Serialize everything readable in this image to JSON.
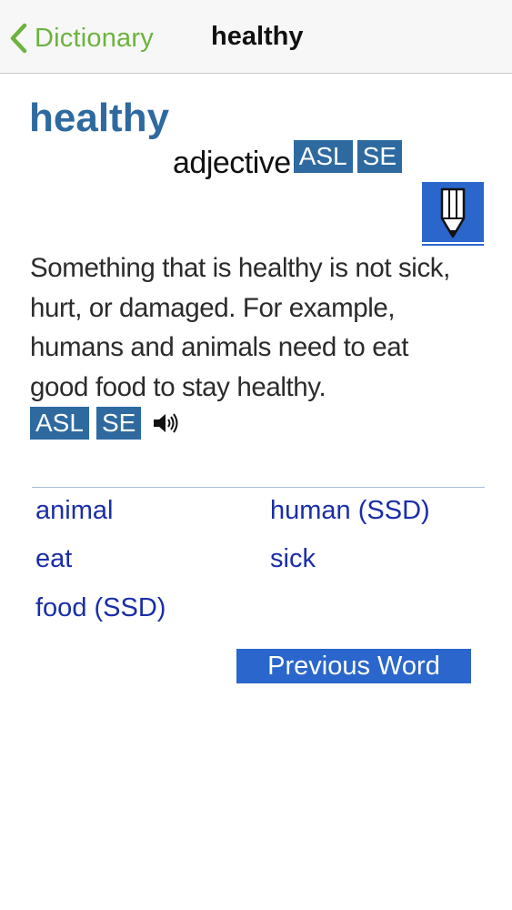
{
  "navbar": {
    "back_label": "Dictionary",
    "title": "healthy"
  },
  "entry": {
    "word": "healthy",
    "part_of_speech": "adjective",
    "word_tags": [
      "ASL",
      "SE"
    ],
    "definition_lines": [
      "Something that is healthy is not sick,",
      "hurt, or damaged. For example,",
      "humans and animals need to eat",
      "good food to stay healthy."
    ],
    "definition_tags": [
      "ASL",
      "SE"
    ]
  },
  "related_words": [
    "animal",
    "human (SSD)",
    "eat",
    "sick",
    "food (SSD)"
  ],
  "actions": {
    "previous_word": "Previous Word"
  },
  "colors": {
    "accent_green": "#6db33f",
    "headword_blue": "#2e6aa0",
    "link_blue": "#1a2ea8",
    "button_blue": "#2a66cc"
  },
  "icons": {
    "back": "chevron-left-icon",
    "pencil": "pencil-icon",
    "speaker": "speaker-icon"
  }
}
